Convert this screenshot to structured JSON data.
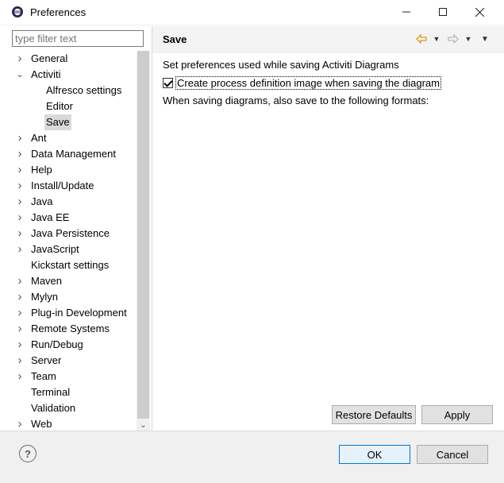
{
  "window": {
    "title": "Preferences"
  },
  "filter": {
    "placeholder": "type filter text",
    "value": ""
  },
  "tree": [
    {
      "label": "General",
      "expandable": true,
      "expanded": false,
      "level": 0
    },
    {
      "label": "Activiti",
      "expandable": true,
      "expanded": true,
      "level": 0
    },
    {
      "label": "Alfresco settings",
      "expandable": false,
      "level": 1
    },
    {
      "label": "Editor",
      "expandable": false,
      "level": 1
    },
    {
      "label": "Save",
      "expandable": false,
      "level": 1,
      "selected": true
    },
    {
      "label": "Ant",
      "expandable": true,
      "expanded": false,
      "level": 0
    },
    {
      "label": "Data Management",
      "expandable": true,
      "expanded": false,
      "level": 0
    },
    {
      "label": "Help",
      "expandable": true,
      "expanded": false,
      "level": 0
    },
    {
      "label": "Install/Update",
      "expandable": true,
      "expanded": false,
      "level": 0
    },
    {
      "label": "Java",
      "expandable": true,
      "expanded": false,
      "level": 0
    },
    {
      "label": "Java EE",
      "expandable": true,
      "expanded": false,
      "level": 0
    },
    {
      "label": "Java Persistence",
      "expandable": true,
      "expanded": false,
      "level": 0
    },
    {
      "label": "JavaScript",
      "expandable": true,
      "expanded": false,
      "level": 0
    },
    {
      "label": "Kickstart settings",
      "expandable": false,
      "level": 0
    },
    {
      "label": "Maven",
      "expandable": true,
      "expanded": false,
      "level": 0
    },
    {
      "label": "Mylyn",
      "expandable": true,
      "expanded": false,
      "level": 0
    },
    {
      "label": "Plug-in Development",
      "expandable": true,
      "expanded": false,
      "level": 0
    },
    {
      "label": "Remote Systems",
      "expandable": true,
      "expanded": false,
      "level": 0
    },
    {
      "label": "Run/Debug",
      "expandable": true,
      "expanded": false,
      "level": 0
    },
    {
      "label": "Server",
      "expandable": true,
      "expanded": false,
      "level": 0
    },
    {
      "label": "Team",
      "expandable": true,
      "expanded": false,
      "level": 0
    },
    {
      "label": "Terminal",
      "expandable": false,
      "level": 0
    },
    {
      "label": "Validation",
      "expandable": false,
      "level": 0
    },
    {
      "label": "Web",
      "expandable": true,
      "expanded": false,
      "level": 0
    }
  ],
  "page": {
    "title": "Save",
    "description": "Set preferences used while saving Activiti Diagrams",
    "checkbox_label": "Create process definition image when saving the diagram",
    "checkbox_checked": true,
    "formats_text": "When saving diagrams, also save to the following formats:",
    "restore_label": "Restore Defaults",
    "apply_label": "Apply"
  },
  "footer": {
    "help_symbol": "?",
    "ok_label": "OK",
    "cancel_label": "Cancel"
  },
  "icons": {
    "back": "back-arrow-icon",
    "forward": "forward-arrow-icon",
    "menu": "view-menu-icon",
    "help": "help-icon"
  },
  "colors": {
    "back_arrow": "#d4a017",
    "ok_border": "#0078d7"
  }
}
